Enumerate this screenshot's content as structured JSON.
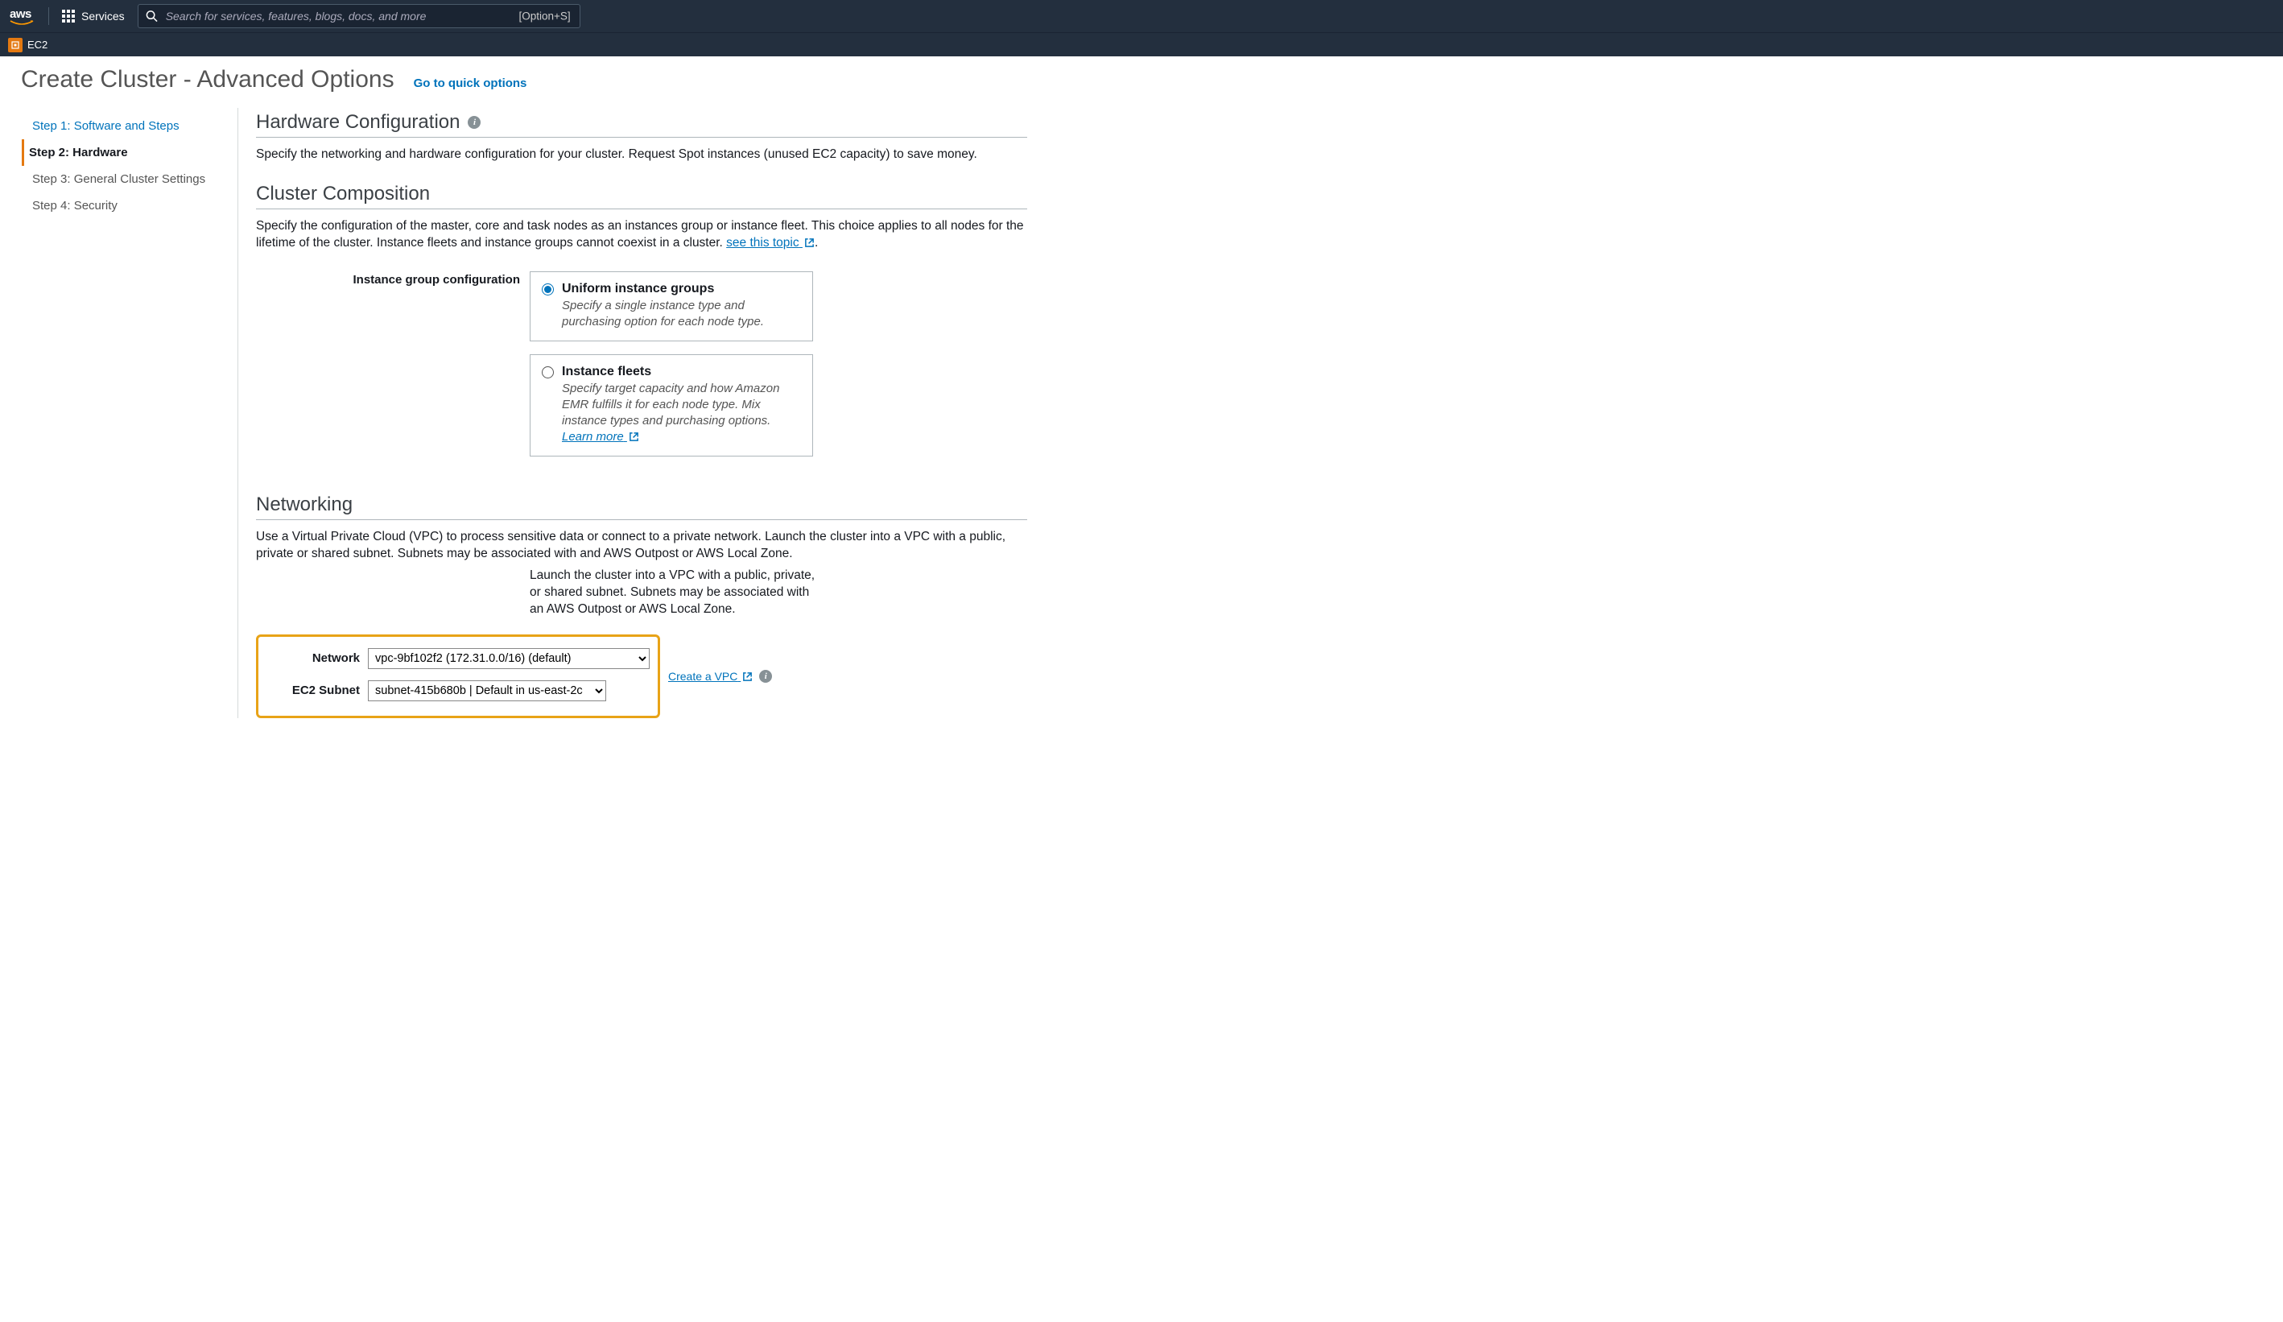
{
  "topnav": {
    "services_label": "Services",
    "search_placeholder": "Search for services, features, blogs, docs, and more",
    "shortcut": "[Option+S]",
    "breadcrumb_service": "EC2"
  },
  "page": {
    "title": "Create Cluster - Advanced Options",
    "quick_link": "Go to quick options"
  },
  "steps": [
    {
      "label": "Step 1: Software and Steps",
      "state": "link"
    },
    {
      "label": "Step 2: Hardware",
      "state": "active"
    },
    {
      "label": "Step 3: General Cluster Settings",
      "state": "disabled"
    },
    {
      "label": "Step 4: Security",
      "state": "disabled"
    }
  ],
  "hardware": {
    "heading": "Hardware Configuration",
    "desc": "Specify the networking and hardware configuration for your cluster. Request Spot instances (unused EC2 capacity) to save money."
  },
  "composition": {
    "heading": "Cluster Composition",
    "desc_a": "Specify the configuration of the master, core and task nodes as an instances group or instance fleet. This choice applies to all nodes for the lifetime of the cluster. Instance fleets and instance groups cannot coexist in a cluster. ",
    "desc_link": "see this topic",
    "desc_b": ".",
    "field_label": "Instance group configuration",
    "options": [
      {
        "title": "Uniform instance groups",
        "desc": "Specify a single instance type and purchasing option for each node type.",
        "selected": true
      },
      {
        "title": "Instance fleets",
        "desc": "Specify target capacity and how Amazon EMR fulfills it for each node type. Mix instance types and purchasing options. ",
        "learn_more": "Learn more",
        "selected": false
      }
    ]
  },
  "networking": {
    "heading": "Networking",
    "desc": "Use a Virtual Private Cloud (VPC) to process sensitive data or connect to a private network. Launch the cluster into a VPC with a public, private or shared subnet. Subnets may be associated with and AWS Outpost or AWS Local Zone.",
    "help": "Launch the cluster into a VPC with a public, private, or shared subnet. Subnets may be associated with an AWS Outpost or AWS Local Zone.",
    "network_label": "Network",
    "network_value": "vpc-9bf102f2 (172.31.0.0/16) (default)",
    "create_vpc": "Create a VPC",
    "subnet_label": "EC2 Subnet",
    "subnet_value": "subnet-415b680b | Default in us-east-2c"
  }
}
